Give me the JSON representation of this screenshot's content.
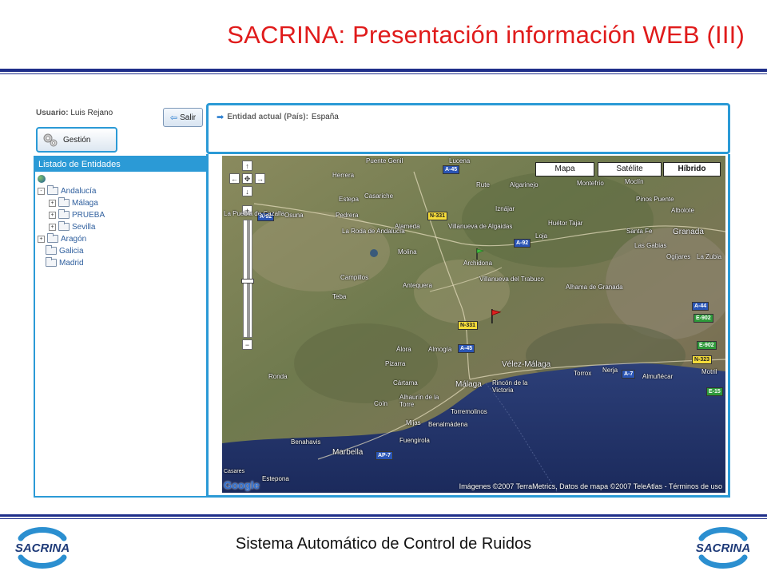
{
  "slide": {
    "title": "SACRINA: Presentación información WEB (III)",
    "footer": "Sistema Automático de Control de Ruidos",
    "logo_text": "SACRINA"
  },
  "app": {
    "user_label": "Usuario:",
    "user_name": "Luis Rejano",
    "salir_label": "Salir",
    "gestion_label": "Gestión",
    "entity_label": "Entidad actual (País):",
    "entity_value": "España",
    "list_title": "Listado de Entidades",
    "tree": [
      {
        "label": "Andalucía",
        "level": 1,
        "expander": "-"
      },
      {
        "label": "Málaga",
        "level": 2,
        "expander": "+"
      },
      {
        "label": "PRUEBA",
        "level": 2,
        "expander": "+"
      },
      {
        "label": "Sevilla",
        "level": 2,
        "expander": "+"
      },
      {
        "label": "Aragón",
        "level": 1,
        "expander": "+"
      },
      {
        "label": "Galicia",
        "level": 1,
        "expander": ""
      },
      {
        "label": "Madrid",
        "level": 1,
        "expander": ""
      }
    ]
  },
  "map": {
    "types": [
      "Mapa",
      "Satélite",
      "Híbrido"
    ],
    "selected_type": "Híbrido",
    "controls": {
      "up": "↑",
      "left": "←",
      "right": "→",
      "down": "↓",
      "center": "✥",
      "zoom_in": "+",
      "zoom_out": "−"
    },
    "places": [
      "Puente Genil",
      "Lucena",
      "Herrera",
      "Rute",
      "Algarinejo",
      "Montefrío",
      "Moclín",
      "Estepa",
      "Casariche",
      "Iznájar",
      "Huétor Tajar",
      "Pinos Puente",
      "Albolote",
      "La Puebla de Cazalla",
      "Osuna",
      "Pedrera",
      "Villanueva de Algaidas",
      "Loja",
      "Santa Fe",
      "Granada",
      "La Roda de Andalucía",
      "Alameda",
      "Las Gabias",
      "Molina",
      "Archidona",
      "Ogíjares",
      "La Zubia",
      "Campillos",
      "Antequera",
      "Villanueva del Trabuco",
      "Alhama de Granada",
      "Teba",
      "Álora",
      "Almogía",
      "Cártama",
      "Vélez-Málaga",
      "Torrox",
      "Nerja",
      "Almuñécar",
      "Motril",
      "Pizarra",
      "Ronda",
      "Málaga",
      "Rincón de la Victoria",
      "Coín",
      "Alhaurín de la Torre",
      "Torremolinos",
      "Mijas",
      "Benalmádena",
      "Marbella",
      "Fuengirola",
      "Benahavis",
      "Casares",
      "Estepona"
    ],
    "roads": [
      {
        "label": "A-45",
        "color": "blue"
      },
      {
        "label": "N-331",
        "color": "yellow"
      },
      {
        "label": "A-92",
        "color": "blue"
      },
      {
        "label": "A-92",
        "color": "blue"
      },
      {
        "label": "N-331",
        "color": "yellow"
      },
      {
        "label": "A-45",
        "color": "blue"
      },
      {
        "label": "A-7",
        "color": "blue"
      },
      {
        "label": "AP-7",
        "color": "blue"
      },
      {
        "label": "A-44",
        "color": "blue"
      },
      {
        "label": "E-902",
        "color": "green"
      },
      {
        "label": "E-902",
        "color": "green"
      },
      {
        "label": "N-323",
        "color": "yellow"
      },
      {
        "label": "E-15",
        "color": "green"
      }
    ],
    "credit": "Imágenes ©2007 TerraMetrics, Datos de mapa ©2007 TeleAtlas - Términos de uso",
    "google": "Google"
  }
}
